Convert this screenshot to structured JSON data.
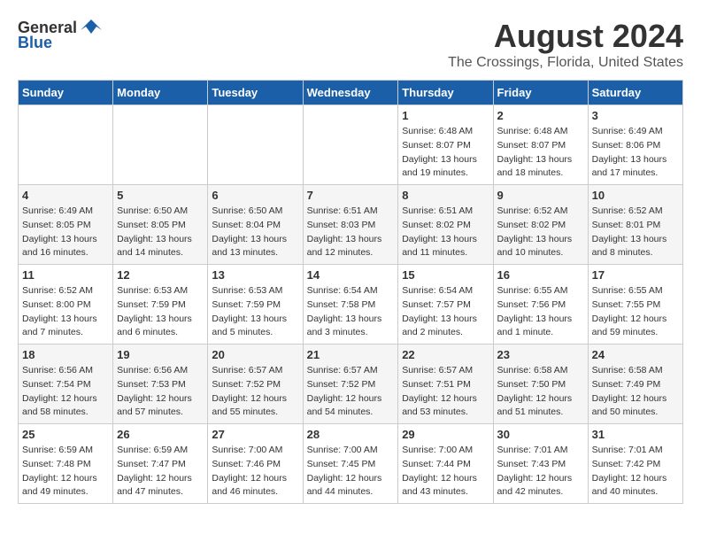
{
  "header": {
    "logo_general": "General",
    "logo_blue": "Blue",
    "month_year": "August 2024",
    "location": "The Crossings, Florida, United States"
  },
  "days_of_week": [
    "Sunday",
    "Monday",
    "Tuesday",
    "Wednesday",
    "Thursday",
    "Friday",
    "Saturday"
  ],
  "weeks": [
    [
      {
        "day": "",
        "info": ""
      },
      {
        "day": "",
        "info": ""
      },
      {
        "day": "",
        "info": ""
      },
      {
        "day": "",
        "info": ""
      },
      {
        "day": "1",
        "info": "Sunrise: 6:48 AM\nSunset: 8:07 PM\nDaylight: 13 hours\nand 19 minutes."
      },
      {
        "day": "2",
        "info": "Sunrise: 6:48 AM\nSunset: 8:07 PM\nDaylight: 13 hours\nand 18 minutes."
      },
      {
        "day": "3",
        "info": "Sunrise: 6:49 AM\nSunset: 8:06 PM\nDaylight: 13 hours\nand 17 minutes."
      }
    ],
    [
      {
        "day": "4",
        "info": "Sunrise: 6:49 AM\nSunset: 8:05 PM\nDaylight: 13 hours\nand 16 minutes."
      },
      {
        "day": "5",
        "info": "Sunrise: 6:50 AM\nSunset: 8:05 PM\nDaylight: 13 hours\nand 14 minutes."
      },
      {
        "day": "6",
        "info": "Sunrise: 6:50 AM\nSunset: 8:04 PM\nDaylight: 13 hours\nand 13 minutes."
      },
      {
        "day": "7",
        "info": "Sunrise: 6:51 AM\nSunset: 8:03 PM\nDaylight: 13 hours\nand 12 minutes."
      },
      {
        "day": "8",
        "info": "Sunrise: 6:51 AM\nSunset: 8:02 PM\nDaylight: 13 hours\nand 11 minutes."
      },
      {
        "day": "9",
        "info": "Sunrise: 6:52 AM\nSunset: 8:02 PM\nDaylight: 13 hours\nand 10 minutes."
      },
      {
        "day": "10",
        "info": "Sunrise: 6:52 AM\nSunset: 8:01 PM\nDaylight: 13 hours\nand 8 minutes."
      }
    ],
    [
      {
        "day": "11",
        "info": "Sunrise: 6:52 AM\nSunset: 8:00 PM\nDaylight: 13 hours\nand 7 minutes."
      },
      {
        "day": "12",
        "info": "Sunrise: 6:53 AM\nSunset: 7:59 PM\nDaylight: 13 hours\nand 6 minutes."
      },
      {
        "day": "13",
        "info": "Sunrise: 6:53 AM\nSunset: 7:59 PM\nDaylight: 13 hours\nand 5 minutes."
      },
      {
        "day": "14",
        "info": "Sunrise: 6:54 AM\nSunset: 7:58 PM\nDaylight: 13 hours\nand 3 minutes."
      },
      {
        "day": "15",
        "info": "Sunrise: 6:54 AM\nSunset: 7:57 PM\nDaylight: 13 hours\nand 2 minutes."
      },
      {
        "day": "16",
        "info": "Sunrise: 6:55 AM\nSunset: 7:56 PM\nDaylight: 13 hours\nand 1 minute."
      },
      {
        "day": "17",
        "info": "Sunrise: 6:55 AM\nSunset: 7:55 PM\nDaylight: 12 hours\nand 59 minutes."
      }
    ],
    [
      {
        "day": "18",
        "info": "Sunrise: 6:56 AM\nSunset: 7:54 PM\nDaylight: 12 hours\nand 58 minutes."
      },
      {
        "day": "19",
        "info": "Sunrise: 6:56 AM\nSunset: 7:53 PM\nDaylight: 12 hours\nand 57 minutes."
      },
      {
        "day": "20",
        "info": "Sunrise: 6:57 AM\nSunset: 7:52 PM\nDaylight: 12 hours\nand 55 minutes."
      },
      {
        "day": "21",
        "info": "Sunrise: 6:57 AM\nSunset: 7:52 PM\nDaylight: 12 hours\nand 54 minutes."
      },
      {
        "day": "22",
        "info": "Sunrise: 6:57 AM\nSunset: 7:51 PM\nDaylight: 12 hours\nand 53 minutes."
      },
      {
        "day": "23",
        "info": "Sunrise: 6:58 AM\nSunset: 7:50 PM\nDaylight: 12 hours\nand 51 minutes."
      },
      {
        "day": "24",
        "info": "Sunrise: 6:58 AM\nSunset: 7:49 PM\nDaylight: 12 hours\nand 50 minutes."
      }
    ],
    [
      {
        "day": "25",
        "info": "Sunrise: 6:59 AM\nSunset: 7:48 PM\nDaylight: 12 hours\nand 49 minutes."
      },
      {
        "day": "26",
        "info": "Sunrise: 6:59 AM\nSunset: 7:47 PM\nDaylight: 12 hours\nand 47 minutes."
      },
      {
        "day": "27",
        "info": "Sunrise: 7:00 AM\nSunset: 7:46 PM\nDaylight: 12 hours\nand 46 minutes."
      },
      {
        "day": "28",
        "info": "Sunrise: 7:00 AM\nSunset: 7:45 PM\nDaylight: 12 hours\nand 44 minutes."
      },
      {
        "day": "29",
        "info": "Sunrise: 7:00 AM\nSunset: 7:44 PM\nDaylight: 12 hours\nand 43 minutes."
      },
      {
        "day": "30",
        "info": "Sunrise: 7:01 AM\nSunset: 7:43 PM\nDaylight: 12 hours\nand 42 minutes."
      },
      {
        "day": "31",
        "info": "Sunrise: 7:01 AM\nSunset: 7:42 PM\nDaylight: 12 hours\nand 40 minutes."
      }
    ]
  ]
}
